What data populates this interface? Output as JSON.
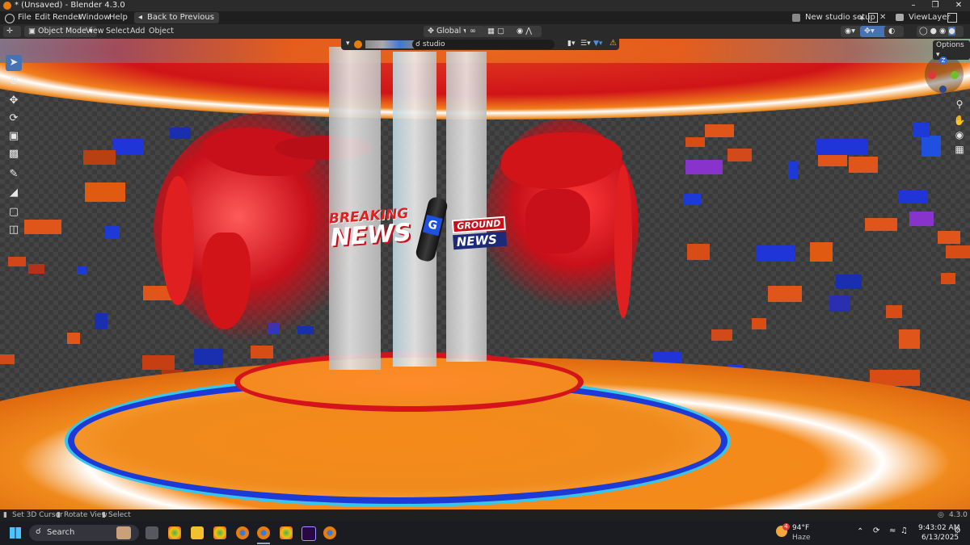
{
  "window": {
    "title": "* (Unsaved) - Blender 4.3.0"
  },
  "menu": {
    "items": [
      "File",
      "Edit",
      "Render",
      "Window",
      "Help"
    ],
    "back_button": "Back to Previous",
    "scene_name": "New studio setup",
    "view_layer": "ViewLayer"
  },
  "viewport_header": {
    "mode": "Object Mode",
    "menus": [
      "View",
      "Select",
      "Add",
      "Object"
    ],
    "orientation": "Global",
    "search_value": "studio",
    "options_label": "Options"
  },
  "gizmo": {
    "z_label": "Z"
  },
  "scene": {
    "headline_top": "BREAKING",
    "headline_bottom": "NEWS",
    "mic_top": "GROUND",
    "mic_bottom": "NEWS",
    "mic_logo": "G",
    "colors": {
      "orange": "#f08a1c",
      "red": "#d4141a",
      "blue": "#1d3ad6",
      "cyan": "#34c6ee"
    }
  },
  "status": {
    "items": [
      "Set 3D Cursor",
      "Rotate View",
      "Select"
    ],
    "version": "4.3.0"
  },
  "taskbar": {
    "search_label": "Search",
    "weather_temp": "94°F",
    "weather_desc": "Haze",
    "notification_count": "4",
    "time": "9:43:02 AM",
    "date": "6/13/2025"
  }
}
